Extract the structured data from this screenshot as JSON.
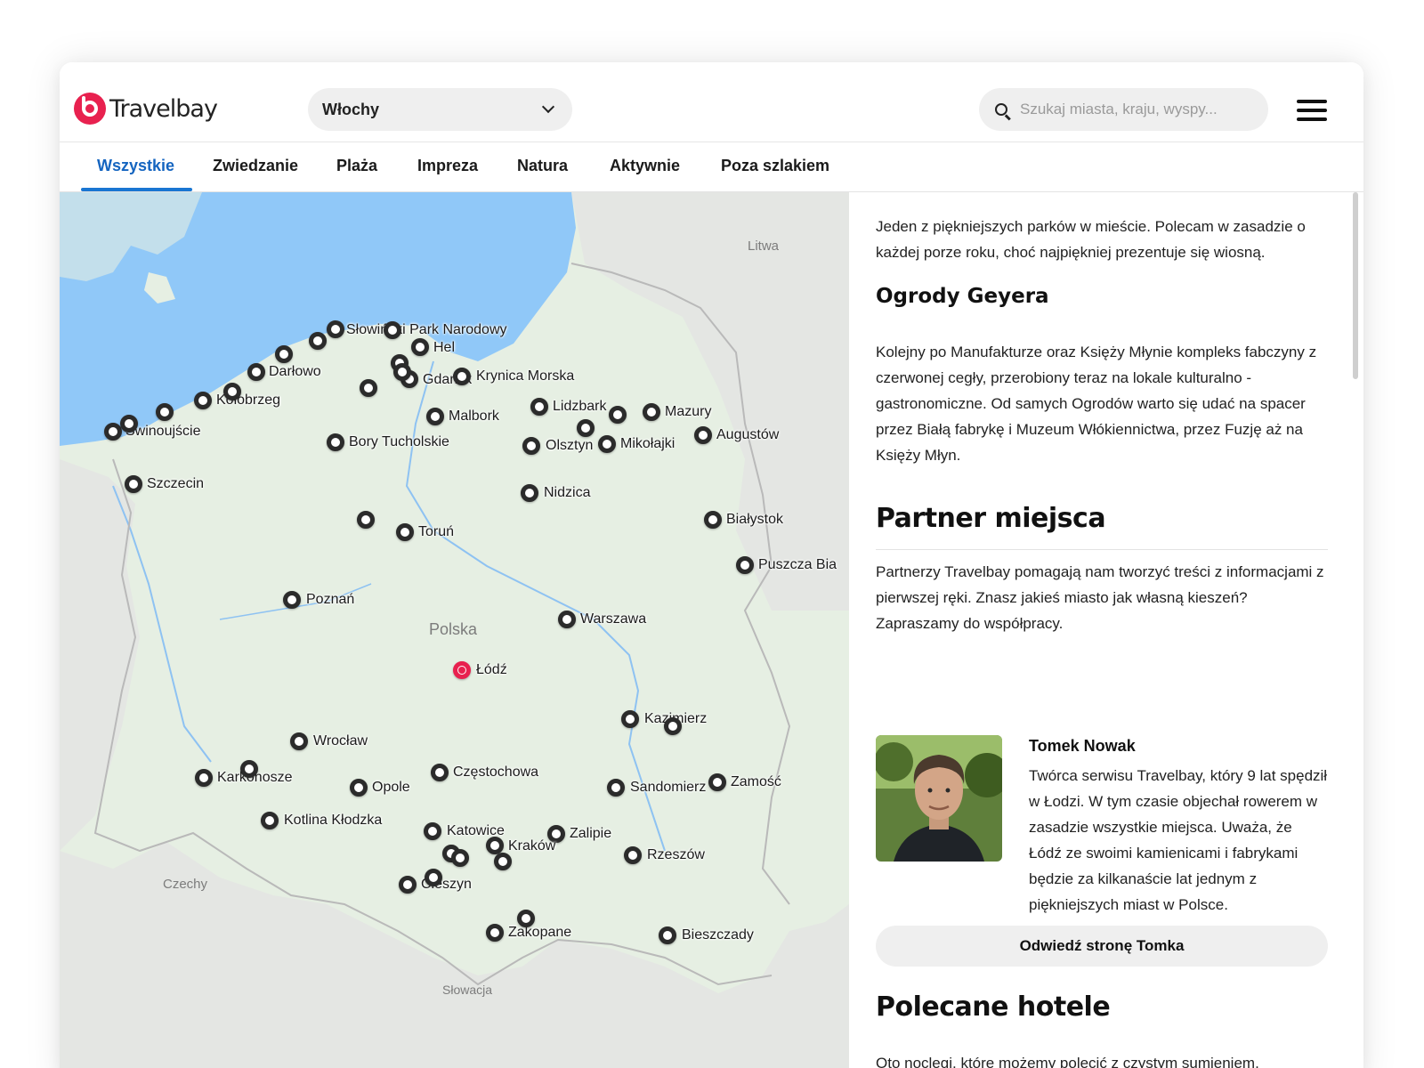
{
  "brand": {
    "name": "Travelbay",
    "color": "#e8214f"
  },
  "header": {
    "country_select": {
      "value": "Włochy"
    },
    "search": {
      "placeholder": "Szukaj miasta, kraju, wyspy..."
    }
  },
  "tabs": [
    {
      "label": "Wszystkie",
      "active": true
    },
    {
      "label": "Zwiedzanie"
    },
    {
      "label": "Plaża"
    },
    {
      "label": "Impreza"
    },
    {
      "label": "Natura"
    },
    {
      "label": "Aktywnie"
    },
    {
      "label": "Poza szlakiem"
    }
  ],
  "map": {
    "region_labels": [
      "Litwa",
      "Polska",
      "Czechy",
      "Słowacja"
    ],
    "places": [
      {
        "label": "Słowiński Park Narodowy"
      },
      {
        "label": "Hel"
      },
      {
        "label": "Darłowo"
      },
      {
        "label": "Gdańsk"
      },
      {
        "label": "Krynica Morska"
      },
      {
        "label": "Kołobrzeg"
      },
      {
        "label": "Świnoujście"
      },
      {
        "label": "Malbork"
      },
      {
        "label": "Lidzbark"
      },
      {
        "label": "Mazury"
      },
      {
        "label": "Olsztyn"
      },
      {
        "label": "Mikołajki"
      },
      {
        "label": "Augustów"
      },
      {
        "label": "Bory Tucholskie"
      },
      {
        "label": "Szczecin"
      },
      {
        "label": "Nidzica"
      },
      {
        "label": "Białystok"
      },
      {
        "label": "Toruń"
      },
      {
        "label": "Puszcza Bia"
      },
      {
        "label": "Poznań"
      },
      {
        "label": "Warszawa"
      },
      {
        "label": "Łódź",
        "selected": true
      },
      {
        "label": "Kazimierz"
      },
      {
        "label": "Wrocław"
      },
      {
        "label": "Karkonosze"
      },
      {
        "label": "Częstochowa"
      },
      {
        "label": "Opole"
      },
      {
        "label": "Sandomierz"
      },
      {
        "label": "Zamość"
      },
      {
        "label": "Kotlina Kłodzka"
      },
      {
        "label": "Katowice"
      },
      {
        "label": "Zalipie"
      },
      {
        "label": "Kraków"
      },
      {
        "label": "Rzeszów"
      },
      {
        "label": "Cieszyn"
      },
      {
        "label": "Zakopane"
      },
      {
        "label": "Bieszczady"
      }
    ]
  },
  "panel": {
    "intro": "Jeden z piękniejszych parków w mieście. Polecam w zasadzie o każdej porze roku, choć najpiękniej prezentuje się wiosną.",
    "place_title": "Ogrody Geyera",
    "place_text": "Kolejny po Manufakturze oraz Księży Młynie kompleks fabczyny z czerwonej cegły, przerobiony teraz na lokale kulturalno - gastronomiczne. Od samych Ogrodów warto się udać na spacer przez Białą fabrykę i Muzeum Włókiennictwa, przez Fuzję aż na Księży Młyn.",
    "partner_title": "Partner miejsca",
    "partner_text": "Partnerzy Travelbay pomagają nam tworzyć treści z informacjami z pierwszej ręki. Znasz jakieś miasto jak własną kieszeń? Zapraszamy do współpracy.",
    "person_name": "Tomek Nowak",
    "person_bio": "Twórca serwisu Travelbay, który 9 lat spędził w Łodzi. W tym czasie objechał rowerem w zasadzie wszystkie miejsca. Uważa, że Łódź ze swoimi kamienicami i fabrykami będzie za kilkanaście lat jednym z piękniejszych miast w Polsce.",
    "visit_button": "Odwiedź stronę Tomka",
    "hotels_title": "Polecane hotele",
    "hotels_text": "Oto noclegi, które możemy polecić z czystym sumieniem. Polecamy tylko takie hotele, które sami odwiedziliśmy."
  },
  "colors": {
    "accent": "#1976d2",
    "water": "#90c8f8",
    "land": "#e6efe3"
  }
}
